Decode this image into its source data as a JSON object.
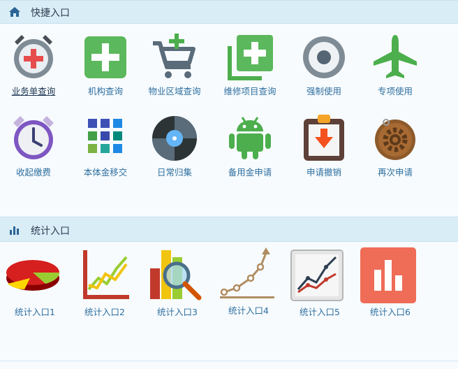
{
  "quick": {
    "title": "快捷入口",
    "header_icon": "home-icon",
    "items": [
      {
        "label": "业务单查询",
        "icon": "alarm-plus-icon"
      },
      {
        "label": "机构查询",
        "icon": "plus-square-icon"
      },
      {
        "label": "物业区域查询",
        "icon": "cart-plus-icon"
      },
      {
        "label": "维修项目查询",
        "icon": "add-copy-icon"
      },
      {
        "label": "强制使用",
        "icon": "radio-record-icon"
      },
      {
        "label": "专项使用",
        "icon": "airplane-icon"
      },
      {
        "label": "收起缴费",
        "icon": "alarm-clock-icon"
      },
      {
        "label": "本体金移交",
        "icon": "tiles-icon"
      },
      {
        "label": "日常归集",
        "icon": "vinyl-disc-icon"
      },
      {
        "label": "备用金申请",
        "icon": "android-icon"
      },
      {
        "label": "申请撤销",
        "icon": "clipboard-download-icon"
      },
      {
        "label": "再次申请",
        "icon": "gear-badge-icon"
      }
    ]
  },
  "stats": {
    "title": "统计入口",
    "header_icon": "bar-chart-icon",
    "items": [
      {
        "label": "统计入口1",
        "icon": "pie-chart-icon"
      },
      {
        "label": "统计入口2",
        "icon": "line-chart-axes-icon"
      },
      {
        "label": "统计入口3",
        "icon": "chart-magnifier-icon"
      },
      {
        "label": "统计入口4",
        "icon": "growth-curve-icon"
      },
      {
        "label": "统计入口5",
        "icon": "line-chart-card-icon"
      },
      {
        "label": "统计入口6",
        "icon": "bar-chart-tile-icon"
      }
    ]
  },
  "colors": {
    "header_bg": "#d9edf7",
    "label": "#2f6f9f",
    "active_label": "#1b3550",
    "accent_green": "#4cae4c",
    "accent_red": "#e84c4c"
  }
}
